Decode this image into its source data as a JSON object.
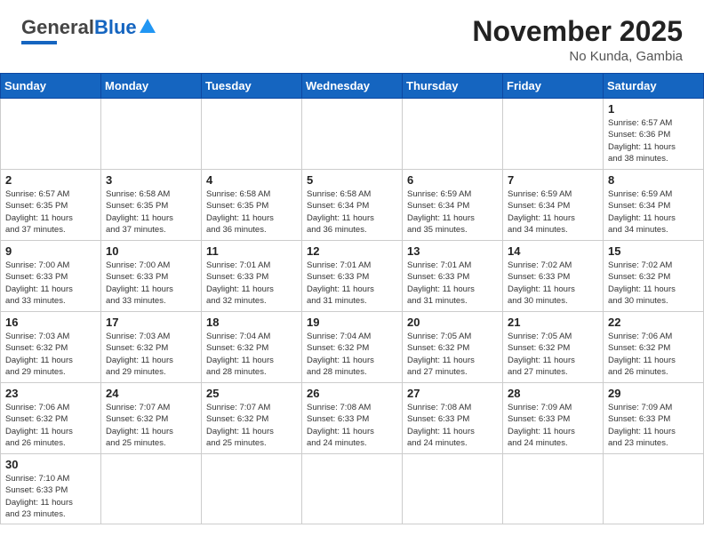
{
  "header": {
    "logo_general": "General",
    "logo_blue": "Blue",
    "month": "November 2025",
    "location": "No Kunda, Gambia"
  },
  "days_of_week": [
    "Sunday",
    "Monday",
    "Tuesday",
    "Wednesday",
    "Thursday",
    "Friday",
    "Saturday"
  ],
  "weeks": [
    [
      {
        "day": "",
        "info": ""
      },
      {
        "day": "",
        "info": ""
      },
      {
        "day": "",
        "info": ""
      },
      {
        "day": "",
        "info": ""
      },
      {
        "day": "",
        "info": ""
      },
      {
        "day": "",
        "info": ""
      },
      {
        "day": "1",
        "info": "Sunrise: 6:57 AM\nSunset: 6:36 PM\nDaylight: 11 hours\nand 38 minutes."
      }
    ],
    [
      {
        "day": "2",
        "info": "Sunrise: 6:57 AM\nSunset: 6:35 PM\nDaylight: 11 hours\nand 37 minutes."
      },
      {
        "day": "3",
        "info": "Sunrise: 6:58 AM\nSunset: 6:35 PM\nDaylight: 11 hours\nand 37 minutes."
      },
      {
        "day": "4",
        "info": "Sunrise: 6:58 AM\nSunset: 6:35 PM\nDaylight: 11 hours\nand 36 minutes."
      },
      {
        "day": "5",
        "info": "Sunrise: 6:58 AM\nSunset: 6:34 PM\nDaylight: 11 hours\nand 36 minutes."
      },
      {
        "day": "6",
        "info": "Sunrise: 6:59 AM\nSunset: 6:34 PM\nDaylight: 11 hours\nand 35 minutes."
      },
      {
        "day": "7",
        "info": "Sunrise: 6:59 AM\nSunset: 6:34 PM\nDaylight: 11 hours\nand 34 minutes."
      },
      {
        "day": "8",
        "info": "Sunrise: 6:59 AM\nSunset: 6:34 PM\nDaylight: 11 hours\nand 34 minutes."
      }
    ],
    [
      {
        "day": "9",
        "info": "Sunrise: 7:00 AM\nSunset: 6:33 PM\nDaylight: 11 hours\nand 33 minutes."
      },
      {
        "day": "10",
        "info": "Sunrise: 7:00 AM\nSunset: 6:33 PM\nDaylight: 11 hours\nand 33 minutes."
      },
      {
        "day": "11",
        "info": "Sunrise: 7:01 AM\nSunset: 6:33 PM\nDaylight: 11 hours\nand 32 minutes."
      },
      {
        "day": "12",
        "info": "Sunrise: 7:01 AM\nSunset: 6:33 PM\nDaylight: 11 hours\nand 31 minutes."
      },
      {
        "day": "13",
        "info": "Sunrise: 7:01 AM\nSunset: 6:33 PM\nDaylight: 11 hours\nand 31 minutes."
      },
      {
        "day": "14",
        "info": "Sunrise: 7:02 AM\nSunset: 6:33 PM\nDaylight: 11 hours\nand 30 minutes."
      },
      {
        "day": "15",
        "info": "Sunrise: 7:02 AM\nSunset: 6:32 PM\nDaylight: 11 hours\nand 30 minutes."
      }
    ],
    [
      {
        "day": "16",
        "info": "Sunrise: 7:03 AM\nSunset: 6:32 PM\nDaylight: 11 hours\nand 29 minutes."
      },
      {
        "day": "17",
        "info": "Sunrise: 7:03 AM\nSunset: 6:32 PM\nDaylight: 11 hours\nand 29 minutes."
      },
      {
        "day": "18",
        "info": "Sunrise: 7:04 AM\nSunset: 6:32 PM\nDaylight: 11 hours\nand 28 minutes."
      },
      {
        "day": "19",
        "info": "Sunrise: 7:04 AM\nSunset: 6:32 PM\nDaylight: 11 hours\nand 28 minutes."
      },
      {
        "day": "20",
        "info": "Sunrise: 7:05 AM\nSunset: 6:32 PM\nDaylight: 11 hours\nand 27 minutes."
      },
      {
        "day": "21",
        "info": "Sunrise: 7:05 AM\nSunset: 6:32 PM\nDaylight: 11 hours\nand 27 minutes."
      },
      {
        "day": "22",
        "info": "Sunrise: 7:06 AM\nSunset: 6:32 PM\nDaylight: 11 hours\nand 26 minutes."
      }
    ],
    [
      {
        "day": "23",
        "info": "Sunrise: 7:06 AM\nSunset: 6:32 PM\nDaylight: 11 hours\nand 26 minutes."
      },
      {
        "day": "24",
        "info": "Sunrise: 7:07 AM\nSunset: 6:32 PM\nDaylight: 11 hours\nand 25 minutes."
      },
      {
        "day": "25",
        "info": "Sunrise: 7:07 AM\nSunset: 6:32 PM\nDaylight: 11 hours\nand 25 minutes."
      },
      {
        "day": "26",
        "info": "Sunrise: 7:08 AM\nSunset: 6:33 PM\nDaylight: 11 hours\nand 24 minutes."
      },
      {
        "day": "27",
        "info": "Sunrise: 7:08 AM\nSunset: 6:33 PM\nDaylight: 11 hours\nand 24 minutes."
      },
      {
        "day": "28",
        "info": "Sunrise: 7:09 AM\nSunset: 6:33 PM\nDaylight: 11 hours\nand 24 minutes."
      },
      {
        "day": "29",
        "info": "Sunrise: 7:09 AM\nSunset: 6:33 PM\nDaylight: 11 hours\nand 23 minutes."
      }
    ],
    [
      {
        "day": "30",
        "info": "Sunrise: 7:10 AM\nSunset: 6:33 PM\nDaylight: 11 hours\nand 23 minutes."
      },
      {
        "day": "",
        "info": ""
      },
      {
        "day": "",
        "info": ""
      },
      {
        "day": "",
        "info": ""
      },
      {
        "day": "",
        "info": ""
      },
      {
        "day": "",
        "info": ""
      },
      {
        "day": "",
        "info": ""
      }
    ]
  ]
}
